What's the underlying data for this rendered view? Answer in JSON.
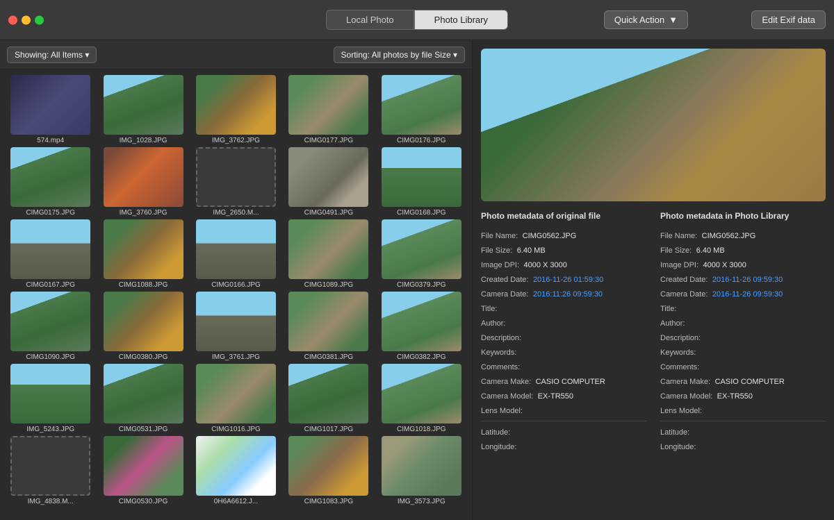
{
  "titleBar": {
    "tabs": [
      {
        "id": "local",
        "label": "Local Photo",
        "active": false
      },
      {
        "id": "library",
        "label": "Photo Library",
        "active": true
      }
    ],
    "quickAction": "Quick Action",
    "editExif": "Edit Exif data"
  },
  "filterBar": {
    "showing": "Showing: All Items ▾",
    "sorting": "Sorting: All photos by file Size ▾"
  },
  "photos": [
    {
      "label": "574.mp4",
      "style": "video"
    },
    {
      "label": "IMG_1028.JPG",
      "style": "park"
    },
    {
      "label": "IMG_3762.JPG",
      "style": "autumn"
    },
    {
      "label": "CIMG0177.JPG",
      "style": "path"
    },
    {
      "label": "CIMG0176.JPG",
      "style": "bench"
    },
    {
      "label": "CIMG0175.JPG",
      "style": "park"
    },
    {
      "label": "IMG_3760.JPG",
      "style": "orange"
    },
    {
      "label": "IMG_2650.M...",
      "style": "dashed"
    },
    {
      "label": "CIMG0491.JPG",
      "style": "monument"
    },
    {
      "label": "CIMG0168.JPG",
      "style": "trees"
    },
    {
      "label": "CIMG0167.JPG",
      "style": "bare"
    },
    {
      "label": "CIMG1088.JPG",
      "style": "autumn"
    },
    {
      "label": "CIMG0166.JPG",
      "style": "bare"
    },
    {
      "label": "CIMG1089.JPG",
      "style": "path"
    },
    {
      "label": "CIMG0379.JPG",
      "style": "bench"
    },
    {
      "label": "CIMG1090.JPG",
      "style": "park"
    },
    {
      "label": "CIMG0380.JPG",
      "style": "autumn"
    },
    {
      "label": "IMG_3761.JPG",
      "style": "bare"
    },
    {
      "label": "CIMG0381.JPG",
      "style": "path"
    },
    {
      "label": "CIMG0382.JPG",
      "style": "bench"
    },
    {
      "label": "IMG_5243.JPG",
      "style": "trees"
    },
    {
      "label": "CIMG0531.JPG",
      "style": "park"
    },
    {
      "label": "CIMG1016.JPG",
      "style": "path"
    },
    {
      "label": "CIMG1017.JPG",
      "style": "park"
    },
    {
      "label": "CIMG1018.JPG",
      "style": "bench"
    },
    {
      "label": "IMG_4838.M...",
      "style": "dashed"
    },
    {
      "label": "CIMG0530.JPG",
      "style": "flowers"
    },
    {
      "label": "0H6A6612.J...",
      "style": "illustration"
    },
    {
      "label": "CIMG1083.JPG",
      "style": "gazebo"
    },
    {
      "label": "IMG_3573.JPG",
      "style": "road"
    }
  ],
  "rightPanel": {
    "previewFile": "CIMG0562.JPG",
    "metaHeaders": {
      "left": "Photo metadata of original file",
      "right": "Photo metadata in Photo Library"
    },
    "metaLeft": {
      "fileName": {
        "label": "File Name:",
        "value": "CIMG0562.JPG"
      },
      "fileSize": {
        "label": "File Size:",
        "value": "6.40 MB"
      },
      "imageDPI": {
        "label": "Image DPI:",
        "value": "4000 X 3000"
      },
      "createdDate": {
        "label": "Created Date:",
        "value": "2016-11-26 01:59:30",
        "isLink": true
      },
      "cameraDate": {
        "label": "Camera Date:",
        "value": "2016:11:26 09:59:30",
        "isLink": true
      },
      "title": {
        "label": "Title:",
        "value": ""
      },
      "author": {
        "label": "Author:",
        "value": ""
      },
      "description": {
        "label": "Description:",
        "value": ""
      },
      "keywords": {
        "label": "Keywords:",
        "value": ""
      },
      "comments": {
        "label": "Comments:",
        "value": ""
      },
      "cameraMake": {
        "label": "Camera Make:",
        "value": "CASIO COMPUTER"
      },
      "cameraModel": {
        "label": "Camera Model:",
        "value": "EX-TR550"
      },
      "lensModel": {
        "label": "Lens Model:",
        "value": ""
      },
      "latitude": {
        "label": "Latitude:",
        "value": ""
      },
      "longitude": {
        "label": "Longitude:",
        "value": ""
      }
    },
    "metaRight": {
      "fileName": {
        "label": "File Name:",
        "value": "CIMG0562.JPG"
      },
      "fileSize": {
        "label": "File Size:",
        "value": "6.40 MB"
      },
      "imageDPI": {
        "label": "Image DPI:",
        "value": "4000 X 3000"
      },
      "createdDate": {
        "label": "Created Date:",
        "value": "2016-11-26 09:59:30",
        "isLink": true
      },
      "cameraDate": {
        "label": "Camera Date:",
        "value": "2016-11-26 09:59:30",
        "isLink": true
      },
      "title": {
        "label": "Title:",
        "value": ""
      },
      "author": {
        "label": "Author:",
        "value": ""
      },
      "description": {
        "label": "Description:",
        "value": ""
      },
      "keywords": {
        "label": "Keywords:",
        "value": ""
      },
      "comments": {
        "label": "Comments:",
        "value": ""
      },
      "cameraMake": {
        "label": "Camera Make:",
        "value": "CASIO COMPUTER"
      },
      "cameraModel": {
        "label": "Camera Model:",
        "value": "EX-TR550"
      },
      "lensModel": {
        "label": "Lens Model:",
        "value": ""
      },
      "latitude": {
        "label": "Latitude:",
        "value": ""
      },
      "longitude": {
        "label": "Longitude:",
        "value": ""
      }
    }
  }
}
